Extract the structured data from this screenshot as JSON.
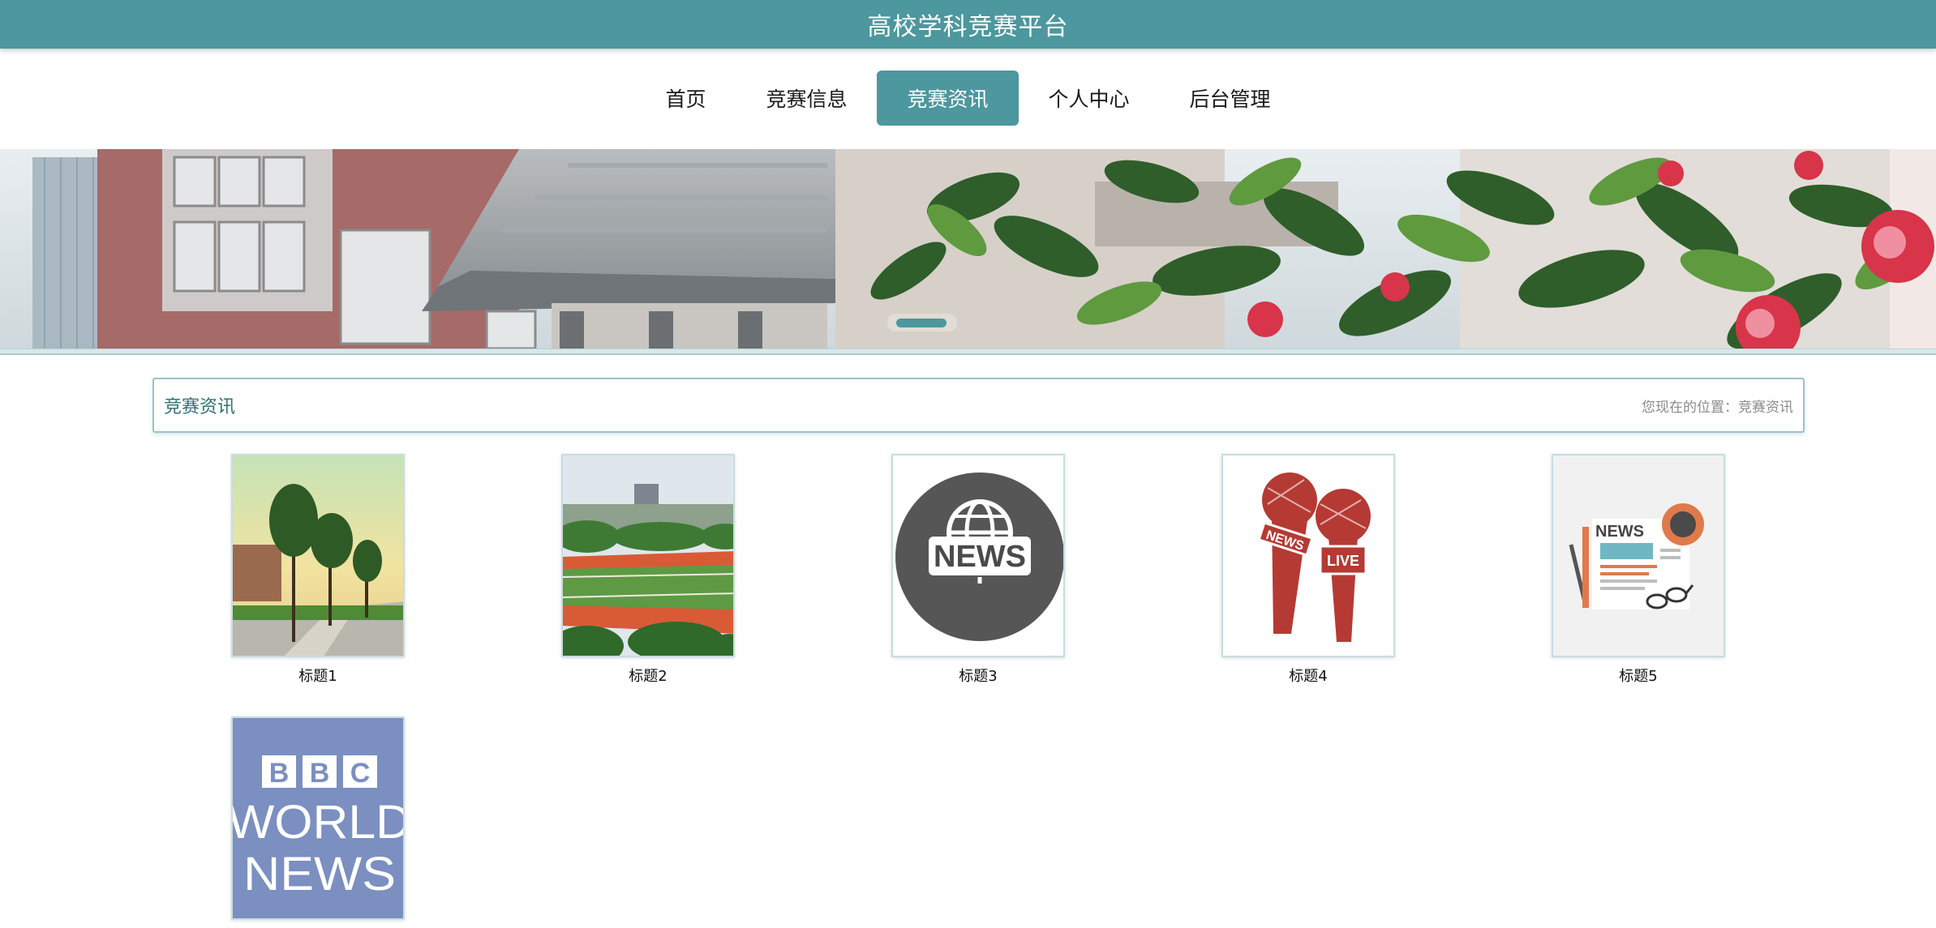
{
  "header": {
    "site_title": "高校学科竞赛平台"
  },
  "nav": {
    "items": [
      {
        "label": "首页",
        "active": false
      },
      {
        "label": "竞赛信息",
        "active": false
      },
      {
        "label": "竞赛资讯",
        "active": true
      },
      {
        "label": "个人中心",
        "active": false
      },
      {
        "label": "后台管理",
        "active": false
      }
    ]
  },
  "section": {
    "title": "竞赛资讯",
    "breadcrumb": "您现在的位置：竞赛资讯"
  },
  "news": {
    "items": [
      {
        "caption": "标题1",
        "image": "campus-trees-image"
      },
      {
        "caption": "标题2",
        "image": "sports-field-image"
      },
      {
        "caption": "标题3",
        "image": "news-globe-icon"
      },
      {
        "caption": "标题4",
        "image": "news-microphones-icon"
      },
      {
        "caption": "标题5",
        "image": "news-paper-icon"
      },
      {
        "caption": "",
        "image": "bbc-world-news-logo",
        "logo_text": "BBC WORLD NEWS"
      }
    ]
  },
  "colors": {
    "accent": "#4d979e",
    "live_red": "#b53a34"
  }
}
